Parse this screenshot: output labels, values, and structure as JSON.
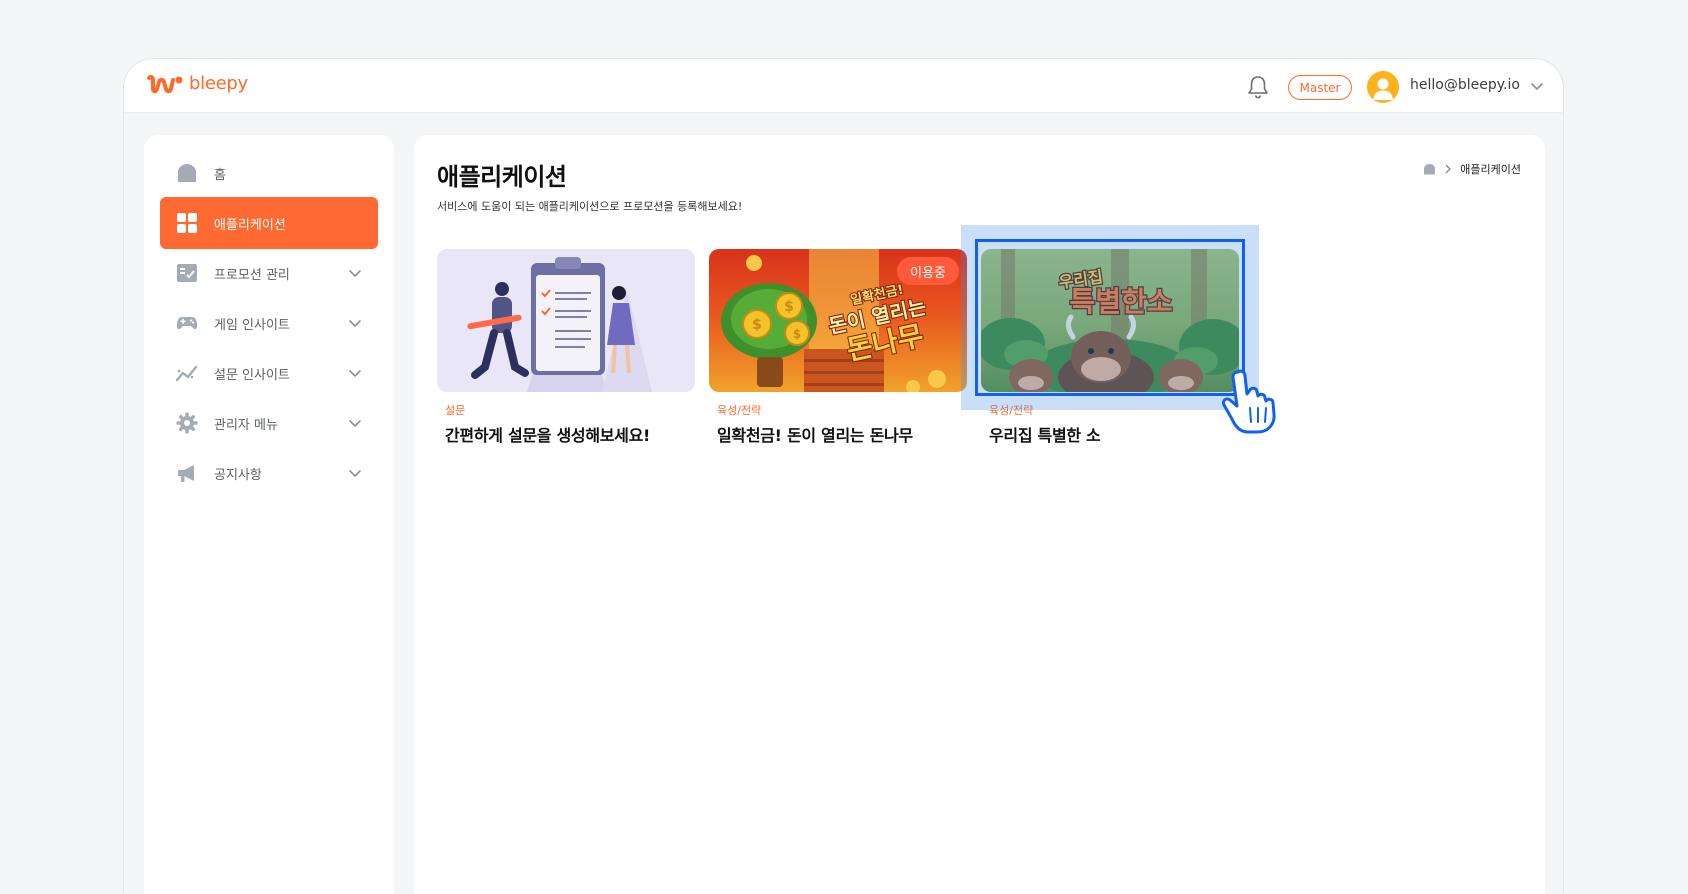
{
  "header": {
    "logo_text": "bleepy",
    "role_badge": "Master",
    "user_email": "hello@bleepy.io"
  },
  "sidebar": {
    "items": [
      {
        "label": "홈",
        "icon": "home-icon",
        "active": false
      },
      {
        "label": "애플리케이션",
        "icon": "grid-icon",
        "active": true
      },
      {
        "label": "프로모션 관리",
        "icon": "promotion-list-icon",
        "active": false,
        "expandable": true
      },
      {
        "label": "게임 인사이트",
        "icon": "gamepad-icon",
        "active": false,
        "expandable": true
      },
      {
        "label": "설문 인사이트",
        "icon": "trend-chart-icon",
        "active": false,
        "expandable": true
      },
      {
        "label": "관리자 메뉴",
        "icon": "gear-icon",
        "active": false,
        "expandable": true
      },
      {
        "label": "공지사항",
        "icon": "megaphone-icon",
        "active": false,
        "expandable": true
      }
    ]
  },
  "main": {
    "title": "애플리케이션",
    "subtitle": "서비스에 도움이 되는 애플리케이션으로 프로모션을 등록해보세요!",
    "breadcrumb": {
      "current": "애플리케이션"
    },
    "cards": [
      {
        "category": "설문",
        "title": "간편하게 설문을 생성해보세요!"
      },
      {
        "category": "육성/전략",
        "title": "일확천금! 돈이 열리는 돈나무",
        "badge": "이용중",
        "art_line1": "일확천금!",
        "art_line2": "돈이 열리는",
        "art_line3": "돈나무"
      },
      {
        "category": "육성/전략",
        "title": "우리집 특별한 소",
        "art_line1": "우리집",
        "art_line2": "특별한소"
      }
    ]
  },
  "colors": {
    "accent": "#ff6a2a",
    "active_nav": "#ff6a32",
    "selection": "#1260f0",
    "selection_fill": "#3c8ceb"
  }
}
